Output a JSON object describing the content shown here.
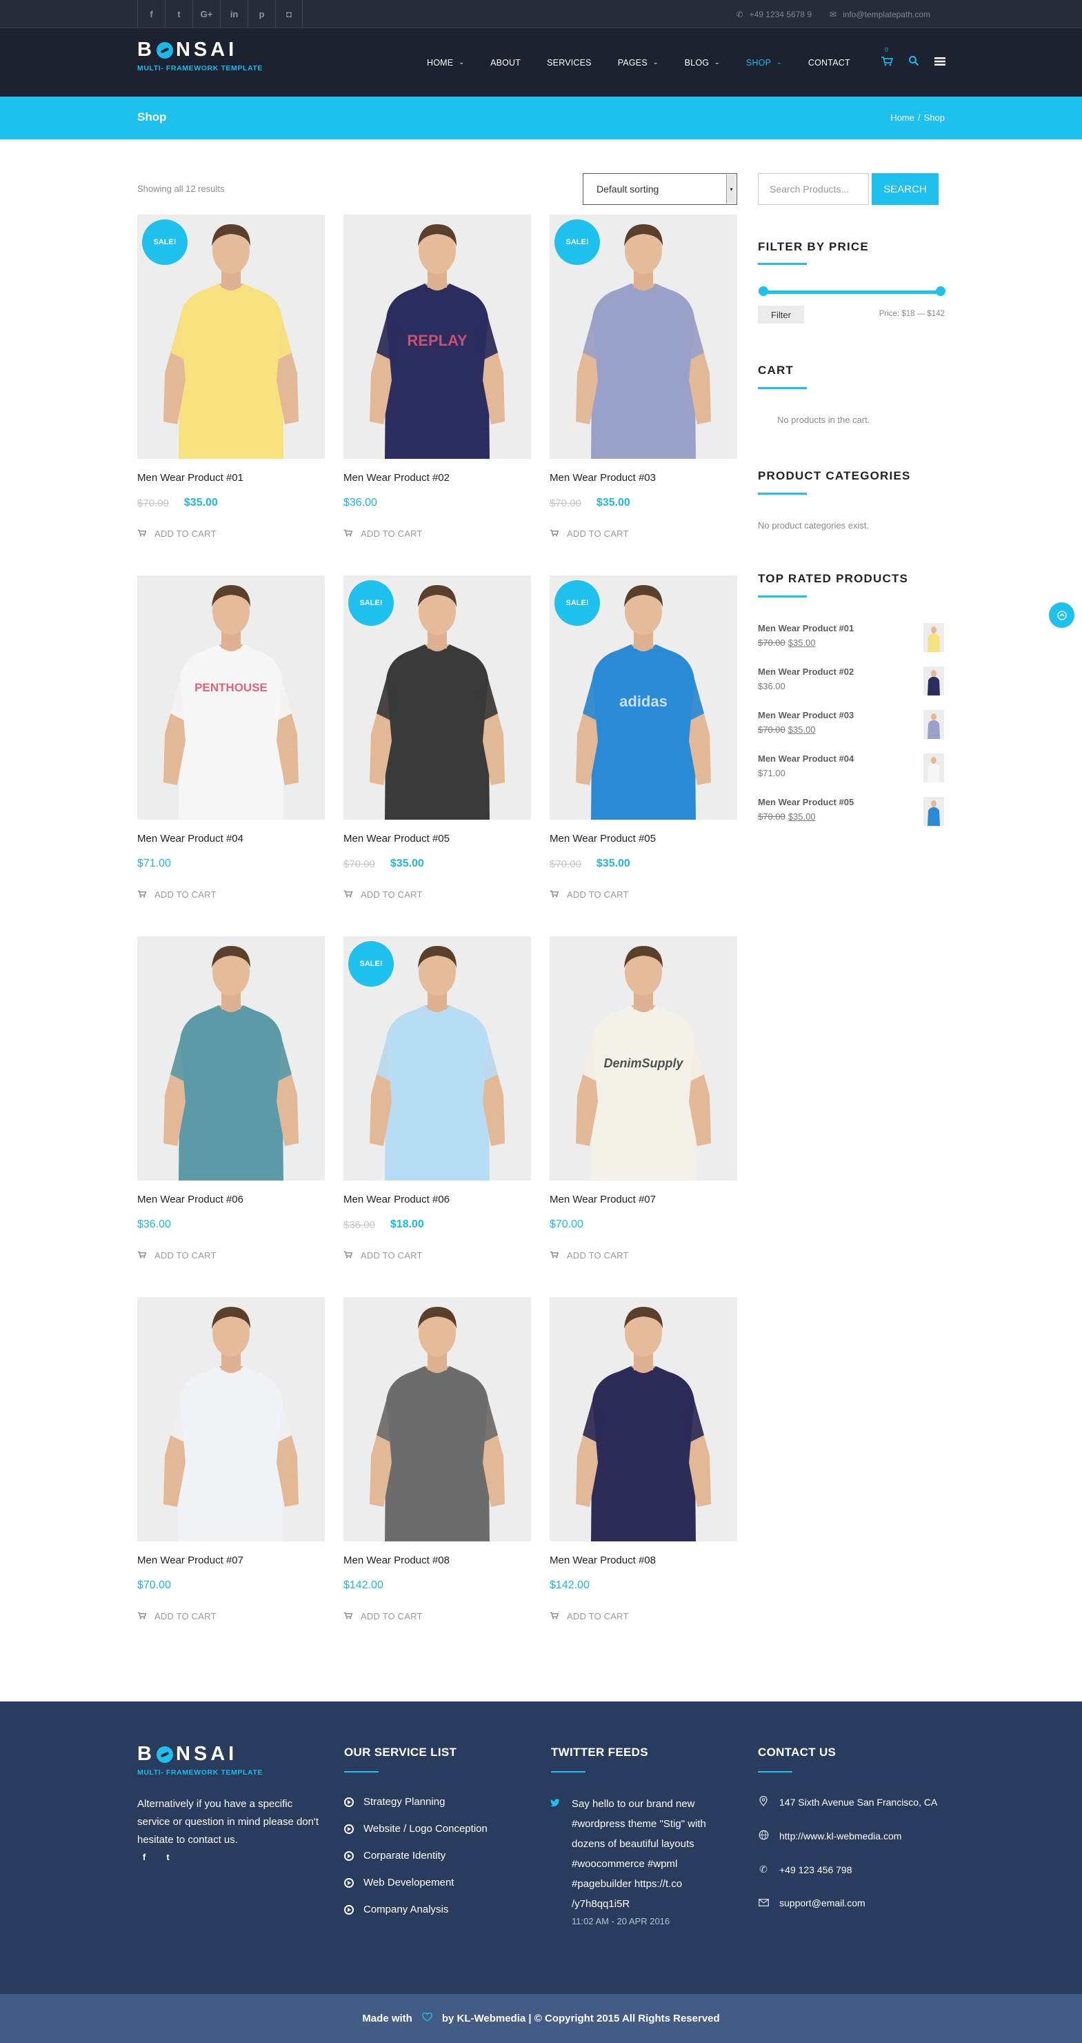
{
  "topbar": {
    "social": [
      {
        "icon": "facebook-icon",
        "glyph": "f"
      },
      {
        "icon": "twitter-icon",
        "glyph": "t"
      },
      {
        "icon": "google-plus-icon",
        "glyph": "G+"
      },
      {
        "icon": "linkedin-icon",
        "glyph": "in"
      },
      {
        "icon": "pinterest-icon",
        "glyph": "p"
      },
      {
        "icon": "instagram-icon",
        "glyph": "◘"
      }
    ],
    "phone": "+49 1234 5678 9",
    "email": "info@templatepath.com"
  },
  "brand": {
    "name_left": "B",
    "name_right": "NSAI",
    "tagline": "MULTI- FRAMEWORK TEMPLATE",
    "accent": "#1ec0ee"
  },
  "nav": {
    "items": [
      {
        "label": "HOME",
        "dropdown": true
      },
      {
        "label": "ABOUT",
        "dropdown": false
      },
      {
        "label": "SERVICES",
        "dropdown": false
      },
      {
        "label": "PAGES",
        "dropdown": true
      },
      {
        "label": "BLOG",
        "dropdown": true
      },
      {
        "label": "SHOP",
        "dropdown": true,
        "active": true
      },
      {
        "label": "CONTACT",
        "dropdown": false
      }
    ],
    "cart_count": "0"
  },
  "titlebar": {
    "title": "Shop",
    "breadcrumb_home": "Home",
    "breadcrumb_sep": "/",
    "breadcrumb_current": "Shop"
  },
  "shop": {
    "result_count": "Showing all 12 results",
    "sort_value": "Default sorting",
    "sale_label": "SALE!",
    "add_to_cart": "ADD TO CART",
    "products": [
      {
        "name": "Men Wear Product #01",
        "old": "$70.00",
        "price": "$35.00",
        "sale": true,
        "shirt": "#f7e17f",
        "print": ""
      },
      {
        "name": "Men Wear Product #02",
        "old": "",
        "price": "$36.00",
        "sale": false,
        "shirt": "#2a2d5e",
        "print": "REPLAY"
      },
      {
        "name": "Men Wear Product #03",
        "old": "$70.00",
        "price": "$35.00",
        "sale": true,
        "shirt": "#9aa1c9",
        "print": ""
      },
      {
        "name": "Men Wear Product #04",
        "old": "",
        "price": "$71.00",
        "sale": false,
        "shirt": "#f6f6f6",
        "print": "PENTHOUSE"
      },
      {
        "name": "Men Wear Product #05",
        "old": "$70.00",
        "price": "$35.00",
        "sale": true,
        "shirt": "#3a3a3a",
        "print": ""
      },
      {
        "name": "Men Wear Product #05",
        "old": "$70.00",
        "price": "$35.00",
        "sale": true,
        "shirt": "#2a8ad6",
        "print": "adidas"
      },
      {
        "name": "Men Wear Product #06",
        "old": "",
        "price": "$36.00",
        "sale": false,
        "shirt": "#5b9aa6",
        "print": ""
      },
      {
        "name": "Men Wear Product #06",
        "old": "$36.00",
        "price": "$18.00",
        "sale": true,
        "shirt": "#b8dcf3",
        "print": ""
      },
      {
        "name": "Men Wear Product #07",
        "old": "",
        "price": "$70.00",
        "sale": false,
        "shirt": "#f4f1e8",
        "print": "DenimSupply"
      },
      {
        "name": "Men Wear Product #07",
        "old": "",
        "price": "$70.00",
        "sale": false,
        "shirt": "#f1f2f6",
        "print": ""
      },
      {
        "name": "Men Wear Product #08",
        "old": "",
        "price": "$142.00",
        "sale": false,
        "shirt": "#6c6c6c",
        "print": ""
      },
      {
        "name": "Men Wear Product #08",
        "old": "",
        "price": "$142.00",
        "sale": false,
        "shirt": "#2d2b58",
        "print": ""
      }
    ]
  },
  "sidebar": {
    "search_placeholder": "Search Products...",
    "search_button": "SEARCH",
    "filter_title": "FILTER BY PRICE",
    "filter_button": "Filter",
    "price_range": "Price: $18 — $142",
    "cart_title": "CART",
    "cart_empty": "No products in the cart.",
    "categories_title": "PRODUCT CATEGORIES",
    "categories_empty": "No product categories exist.",
    "top_rated_title": "TOP RATED PRODUCTS",
    "top_rated": [
      {
        "name": "Men Wear Product #01",
        "old": "$70.00",
        "price": "$35.00",
        "shirt": "#f7e17f"
      },
      {
        "name": "Men Wear Product #02",
        "old": "",
        "price": "$36.00",
        "shirt": "#2a2d5e"
      },
      {
        "name": "Men Wear Product #03",
        "old": "$70.00",
        "price": "$35.00",
        "shirt": "#9aa1c9"
      },
      {
        "name": "Men Wear Product #04",
        "old": "",
        "price": "$71.00",
        "shirt": "#f6f6f6"
      },
      {
        "name": "Men Wear Product #05",
        "old": "$70.00",
        "price": "$35.00",
        "shirt": "#2a8ad6"
      }
    ]
  },
  "footer": {
    "about": "Alternatively if you have a specific service or question in mind please don't hesitate to contact us.",
    "services_title": "OUR SERVICE LIST",
    "services": [
      "Strategy Planning",
      "Website / Logo Conception",
      "Corparate Identity",
      "Web Developement",
      "Company Analysis"
    ],
    "twitter_title": "TWITTER FEEDS",
    "tweet": "Say hello to our brand new #wordpress theme \"Stig\" with dozens of beautiful layouts #woocommerce #wpml #pagebuilder https://t.co /y7h8qq1i5R",
    "tweet_time": "11:02 AM - 20 APR 2016",
    "contact_title": "CONTACT US",
    "address": "147 Sixth Avenue San Francisco, CA",
    "website": "http://www.kl-webmedia.com",
    "phone": "+49 123 456 798",
    "email": "support@email.com",
    "copyright_made": "Made with",
    "copyright_rest": "by KL-Webmedia | © Copyright 2015 All Rights Reserved"
  }
}
